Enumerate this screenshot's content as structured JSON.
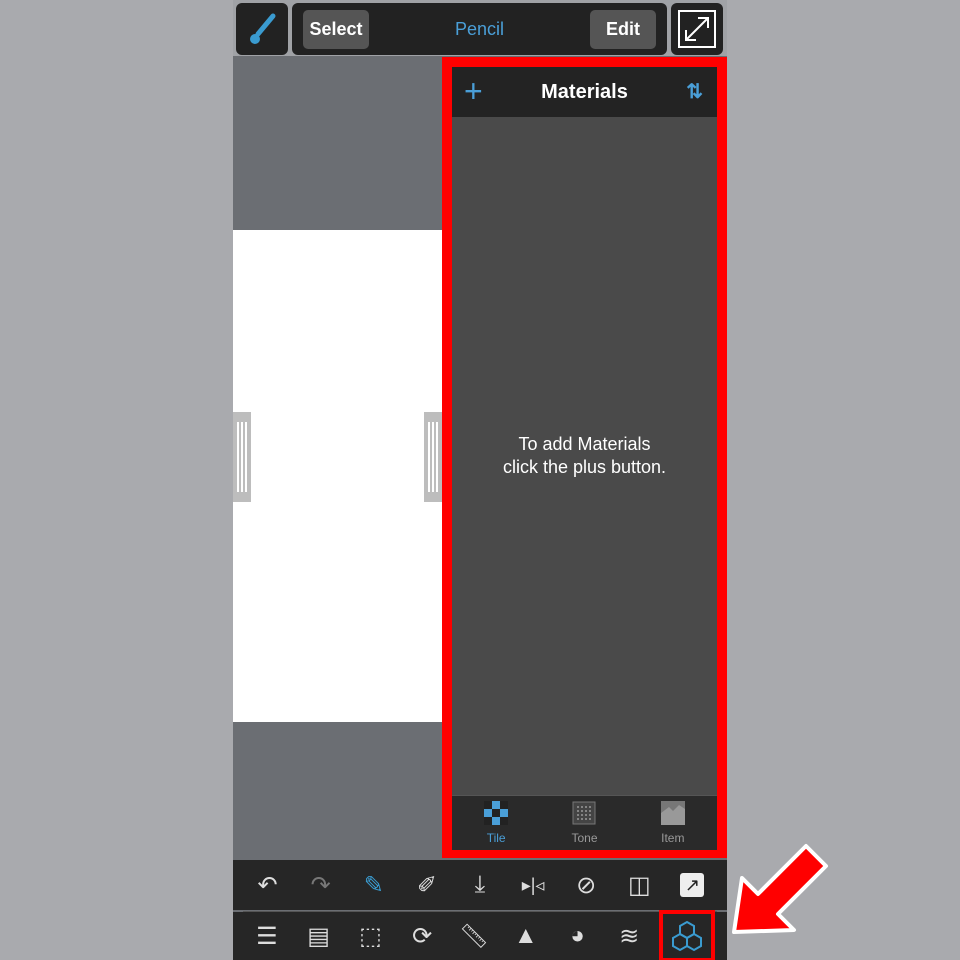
{
  "toolbar": {
    "select_label": "Select",
    "tool_name": "Pencil",
    "edit_label": "Edit"
  },
  "materials": {
    "title": "Materials",
    "empty_message_line1": "To add Materials",
    "empty_message_line2": "click the plus button.",
    "tabs": [
      {
        "label": "Tile",
        "active": true
      },
      {
        "label": "Tone",
        "active": false
      },
      {
        "label": "Item",
        "active": false
      }
    ]
  },
  "colors": {
    "accent": "#4a9fd8",
    "highlight": "#ff0000"
  },
  "bottom_tools_row1": [
    "undo-icon",
    "redo-icon",
    "brush-transform-icon",
    "eyedropper-icon",
    "download-icon",
    "mirror-icon",
    "rotation-lock-icon",
    "eraser-canvas-icon",
    "share-icon"
  ],
  "bottom_tools_row2": [
    "menu-icon",
    "pages-icon",
    "selection-icon",
    "rotate-icon",
    "ruler-icon",
    "fill-icon",
    "palette-icon",
    "layers-icon",
    "materials-icon"
  ]
}
